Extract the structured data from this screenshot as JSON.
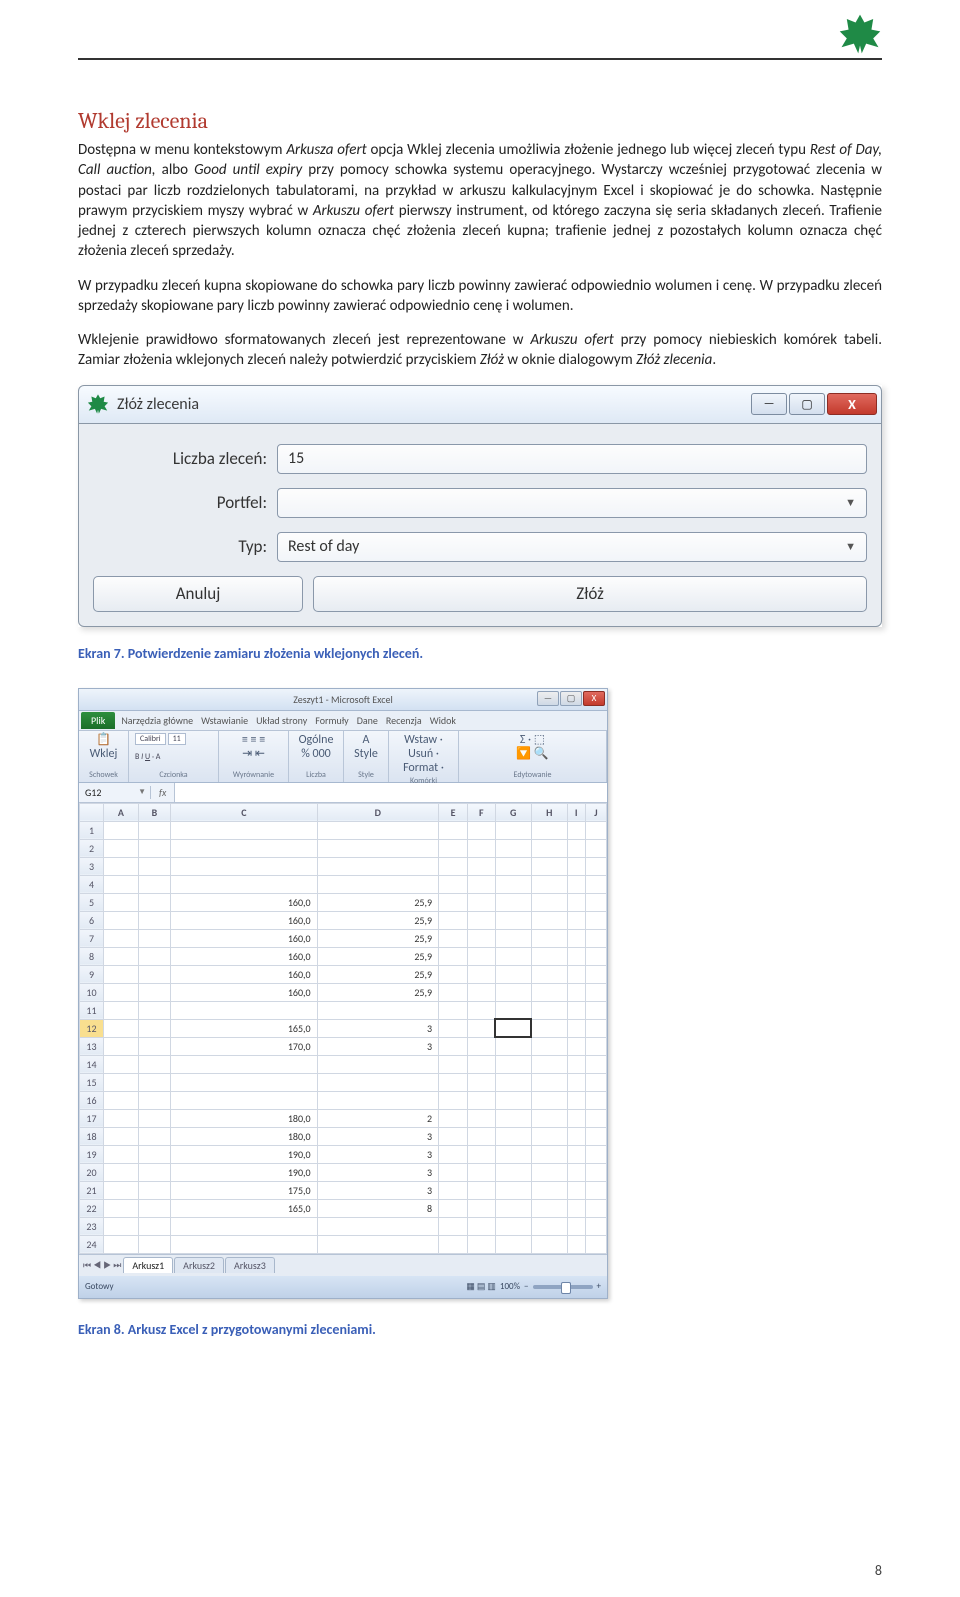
{
  "heading": "Wklej zlecenia",
  "paragraphs": {
    "p1a": "Dostępna w menu kontekstowym ",
    "p1b": "Arkusza ofert",
    "p1c": " opcja Wklej zlecenia umożliwia złożenie jednego lub więcej zleceń typu ",
    "p1d": "Rest of Day, Call auction,",
    "p1e": " albo ",
    "p1f": "Good until expiry",
    "p1g": " przy pomocy schowka systemu operacyjnego. Wystarczy wcześniej przygotować zlecenia w postaci par liczb rozdzielonych tabulatorami, na przykład w arkuszu kalkulacyjnym Excel i skopiować je do schowka. Następnie prawym przyciskiem myszy wybrać w ",
    "p1h": "Arkuszu ofert",
    "p1i": " pierwszy instrument, od którego zaczyna się seria składanych zleceń. Trafienie jednej z czterech pierwszych kolumn oznacza chęć złożenia zleceń kupna; trafienie jednej z pozostałych kolumn oznacza chęć złożenia zleceń sprzedaży.",
    "p2": "W przypadku zleceń kupna skopiowane do schowka pary liczb powinny zawierać odpowiednio wolumen i cenę. W przypadku zleceń sprzedaży skopiowane pary liczb powinny zawierać odpowiednio cenę i wolumen.",
    "p3a": "Wklejenie prawidłowo sformatowanych zleceń jest reprezentowane w ",
    "p3b": "Arkuszu ofert",
    "p3c": " przy pomocy niebieskich komórek tabeli. Zamiar złożenia wklejonych zleceń należy potwierdzić przyciskiem ",
    "p3d": "Złóż",
    "p3e": " w oknie dialogowym ",
    "p3f": "Złóż zlecenia",
    "p3g": "."
  },
  "dialog": {
    "title": "Złóż zlecenia",
    "minimize": "—",
    "maximize": "▢",
    "close": "X",
    "rows": {
      "count_label": "Liczba zleceń:",
      "count_value": "15",
      "portfel_label": "Portfel:",
      "portfel_value": "",
      "typ_label": "Typ:",
      "typ_value": "Rest of day"
    },
    "cancel": "Anuluj",
    "submit": "Złóż"
  },
  "caption1": "Ekran 7. Potwierdzenie zamiaru złożenia wklejonych zleceń.",
  "excel": {
    "title": "Zeszyt1 - Microsoft Excel",
    "file": "Plik",
    "tabs": [
      "Narzędzia główne",
      "Wstawianie",
      "Układ strony",
      "Formuły",
      "Dane",
      "Recenzja",
      "Widok"
    ],
    "ribbon_groups": [
      "Schowek",
      "Czcionka",
      "Wyrównanie",
      "Liczba",
      "Style",
      "Komórki",
      "Edytowanie"
    ],
    "font": "Calibri",
    "fontsize": "11",
    "cellref": "G12",
    "fx": "fx",
    "cols": [
      "A",
      "B",
      "C",
      "D",
      "E",
      "F",
      "G",
      "H",
      "I",
      "J"
    ],
    "rows": [
      {
        "n": "1"
      },
      {
        "n": "2"
      },
      {
        "n": "3"
      },
      {
        "n": "4"
      },
      {
        "n": "5",
        "c": "160,0",
        "d": "25,9"
      },
      {
        "n": "6",
        "c": "160,0",
        "d": "25,9"
      },
      {
        "n": "7",
        "c": "160,0",
        "d": "25,9"
      },
      {
        "n": "8",
        "c": "160,0",
        "d": "25,9"
      },
      {
        "n": "9",
        "c": "160,0",
        "d": "25,9"
      },
      {
        "n": "10",
        "c": "160,0",
        "d": "25,9"
      },
      {
        "n": "11"
      },
      {
        "n": "12",
        "c": "165,0",
        "d": "3",
        "sel": true
      },
      {
        "n": "13",
        "c": "170,0",
        "d": "3"
      },
      {
        "n": "14"
      },
      {
        "n": "15"
      },
      {
        "n": "16"
      },
      {
        "n": "17",
        "c": "180,0",
        "d": "2"
      },
      {
        "n": "18",
        "c": "180,0",
        "d": "3"
      },
      {
        "n": "19",
        "c": "190,0",
        "d": "3"
      },
      {
        "n": "20",
        "c": "190,0",
        "d": "3"
      },
      {
        "n": "21",
        "c": "175,0",
        "d": "3"
      },
      {
        "n": "22",
        "c": "165,0",
        "d": "8"
      },
      {
        "n": "23"
      },
      {
        "n": "24"
      }
    ],
    "sheets": [
      "Arkusz1",
      "Arkusz2",
      "Arkusz3"
    ],
    "status": "Gotowy",
    "zoom": "100%"
  },
  "caption2": "Ekran 8. Arkusz Excel z przygotowanymi zleceniami.",
  "page_number": "8"
}
